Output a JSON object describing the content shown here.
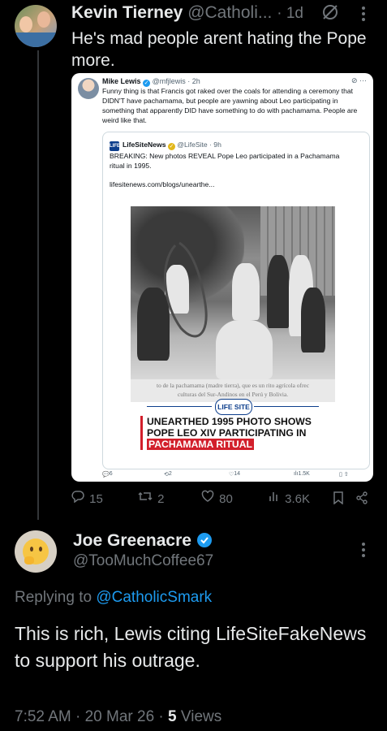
{
  "tweet1": {
    "name": "Kevin Tierney",
    "handle": "@Catholi...",
    "time": "· 1d",
    "text": "He's mad people arent hating the Pope more.",
    "stats": {
      "replies": "15",
      "reposts": "2",
      "likes": "80",
      "views": "3.6K"
    }
  },
  "quoted_screenshot": {
    "author": "Mike Lewis",
    "handle": "@mfjlewis · 2h",
    "text": "Funny thing is that Francis got raked over the coals for attending a ceremony that DIDN'T have pachamama, but people are yawning about Leo participating in something that apparently DID have something to do with pachamama. People are weird like that.",
    "inner": {
      "logo": "LIFE",
      "author": "LifeSiteNews",
      "handle": "@LifeSite · 9h",
      "text": "BREAKING: New photos REVEAL Pope Leo participated in a Pachamama ritual in 1995.",
      "link": "lifesitenews.com/blogs/unearthe...",
      "caption_line1": "to de la pachamama (madre tierra), que es un rito agrícola ofrec",
      "caption_line2": "culturas del Sur-Andinos en el Perú y Bolivia.",
      "badge": "LIFE SITE",
      "headline_part1": "UNEARTHED 1995 PHOTO SHOWS POPE LEO XIV PARTICIPATING IN",
      "headline_highlight": "PACHAMAMA RITUAL"
    },
    "stats": {
      "replies": "6",
      "reposts": "2",
      "likes": "14",
      "views": "1.5K"
    }
  },
  "tweet2": {
    "name": "Joe Greenacre",
    "handle": "@TooMuchCoffee67",
    "replying_prefix": "Replying to",
    "replying_to": "@CatholicSmark",
    "text": "This is rich, Lewis citing LifeSiteFakeNews to support his outrage.",
    "time": "7:52 AM · 20 Mar 26 ·",
    "views_count": "5",
    "views_label": "Views"
  },
  "colors": {
    "background": "#000000",
    "accent": "#1d9bf0",
    "muted": "#71767b",
    "text": "#e7e9ea",
    "highlight_red": "#d21f2b"
  },
  "icons": [
    "more-icon",
    "grok-ghost-icon",
    "reply-icon",
    "repost-icon",
    "like-icon",
    "views-icon",
    "bookmark-icon",
    "share-icon",
    "verified-icon"
  ]
}
